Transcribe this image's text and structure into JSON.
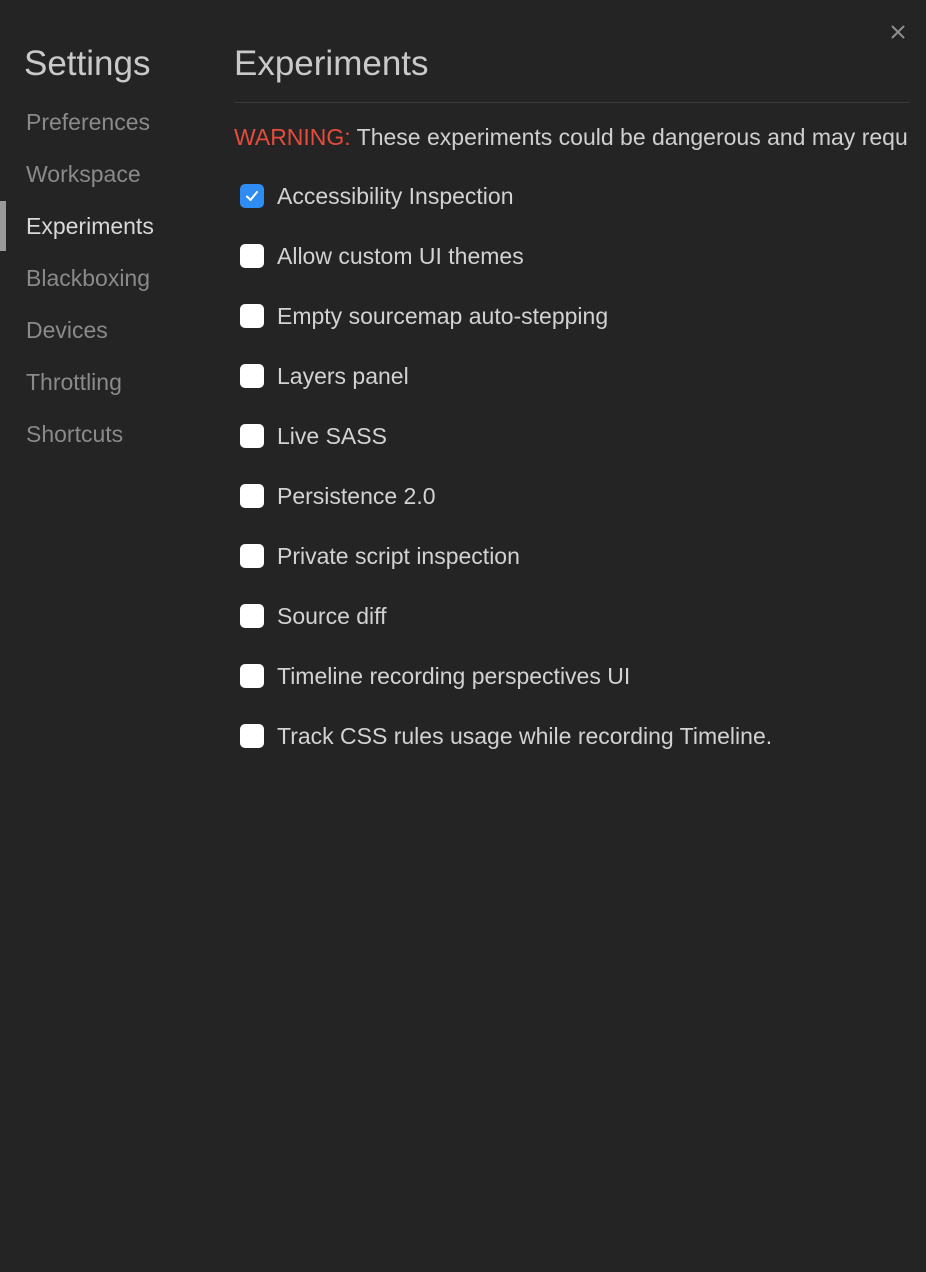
{
  "sidebar": {
    "title": "Settings",
    "items": [
      {
        "label": "Preferences",
        "active": false
      },
      {
        "label": "Workspace",
        "active": false
      },
      {
        "label": "Experiments",
        "active": true
      },
      {
        "label": "Blackboxing",
        "active": false
      },
      {
        "label": "Devices",
        "active": false
      },
      {
        "label": "Throttling",
        "active": false
      },
      {
        "label": "Shortcuts",
        "active": false
      }
    ]
  },
  "main": {
    "title": "Experiments",
    "warning_label": "WARNING:",
    "warning_text": " These experiments could be dangerous and may requ",
    "experiments": [
      {
        "label": "Accessibility Inspection",
        "checked": true
      },
      {
        "label": "Allow custom UI themes",
        "checked": false
      },
      {
        "label": "Empty sourcemap auto-stepping",
        "checked": false
      },
      {
        "label": "Layers panel",
        "checked": false
      },
      {
        "label": "Live SASS",
        "checked": false
      },
      {
        "label": "Persistence 2.0",
        "checked": false
      },
      {
        "label": "Private script inspection",
        "checked": false
      },
      {
        "label": "Source diff",
        "checked": false
      },
      {
        "label": "Timeline recording perspectives UI",
        "checked": false
      },
      {
        "label": "Track CSS rules usage while recording Timeline.",
        "checked": false
      }
    ]
  },
  "icons": {
    "close": "close-icon",
    "check": "checkmark-icon"
  },
  "colors": {
    "background": "#242424",
    "warning": "#e64b3c",
    "checkbox_checked": "#2f8cf2",
    "active_indicator": "#9a9a9a"
  }
}
